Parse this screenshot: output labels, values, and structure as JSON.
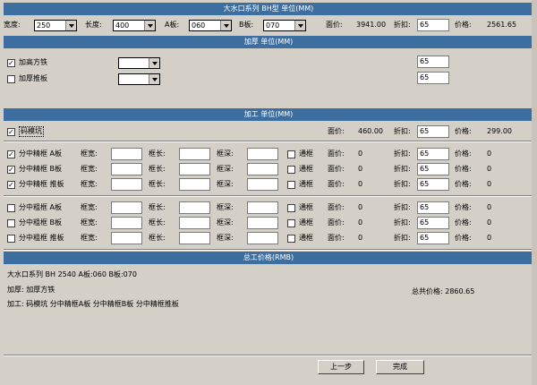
{
  "header": {
    "title": "大水口系列 BH型 单位(MM)"
  },
  "size_row": {
    "width_label": "宽度:",
    "width_value": "250",
    "length_label": "长度:",
    "length_value": "400",
    "a_label": "A板:",
    "a_value": "060",
    "b_label": "B板:",
    "b_value": "070",
    "price_label": "面价:",
    "price_value": "3941.00",
    "discount_label": "折扣:",
    "discount_value": "65",
    "total_label": "价格:",
    "total_value": "2561.65"
  },
  "thick_section": {
    "title": "加厚 单位(MM)",
    "items": [
      {
        "label": "加高方铁",
        "checked": true,
        "select": "",
        "discount": "65"
      },
      {
        "label": "加厚推板",
        "checked": false,
        "select": "",
        "discount": "65"
      }
    ]
  },
  "process_section": {
    "title": "加工 单位(MM)",
    "mold": {
      "label": "码模坑",
      "checked": true,
      "price_label": "面价:",
      "price_value": "460.00",
      "discount_label": "折扣:",
      "discount_value": "65",
      "total_label": "价格:",
      "total_value": "299.00"
    },
    "fine_rows": [
      {
        "label": "分中精框 A板",
        "checked": true,
        "width_label": "框宽:",
        "length_label": "框长:",
        "depth_label": "框深:",
        "through_label": "通框",
        "price_label": "面价:",
        "price": "0",
        "discount_label": "折扣:",
        "discount": "65",
        "total_label": "价格:",
        "total": "0"
      },
      {
        "label": "分中精框 B板",
        "checked": true,
        "width_label": "框宽:",
        "length_label": "框长:",
        "depth_label": "框深:",
        "through_label": "通框",
        "price_label": "面价:",
        "price": "0",
        "discount_label": "折扣:",
        "discount": "65",
        "total_label": "价格:",
        "total": "0"
      },
      {
        "label": "分中精框 推板",
        "checked": true,
        "width_label": "框宽:",
        "length_label": "框长:",
        "depth_label": "框深:",
        "through_label": "通框",
        "price_label": "面价:",
        "price": "0",
        "discount_label": "折扣:",
        "discount": "65",
        "total_label": "价格:",
        "total": "0"
      }
    ],
    "rough_rows": [
      {
        "label": "分中粗框 A板",
        "checked": false,
        "width_label": "框宽:",
        "length_label": "框长:",
        "depth_label": "框深:",
        "through_label": "通框",
        "price_label": "面价:",
        "price": "0",
        "discount_label": "折扣:",
        "discount": "65",
        "total_label": "价格:",
        "total": "0"
      },
      {
        "label": "分中粗框 B板",
        "checked": false,
        "width_label": "框宽:",
        "length_label": "框长:",
        "depth_label": "框深:",
        "through_label": "通框",
        "price_label": "面价:",
        "price": "0",
        "discount_label": "折扣:",
        "discount": "65",
        "total_label": "价格:",
        "total": "0"
      },
      {
        "label": "分中粗框 推板",
        "checked": false,
        "width_label": "框宽:",
        "length_label": "框长:",
        "depth_label": "框深:",
        "through_label": "通框",
        "price_label": "面价:",
        "price": "0",
        "discount_label": "折扣:",
        "discount": "65",
        "total_label": "价格:",
        "total": "0"
      }
    ]
  },
  "summary_section": {
    "title": "总工价格(RMB)",
    "line1": "大水口系列 BH 2540 A板:060 B板:070",
    "line2": "加厚:  加厚方铁",
    "line3": "加工: 码模坑 分中精框A板 分中精框B板 分中精框推板",
    "total": "总共价格: 2860.65"
  },
  "buttons": {
    "prev": "上一步",
    "finish": "完成"
  }
}
